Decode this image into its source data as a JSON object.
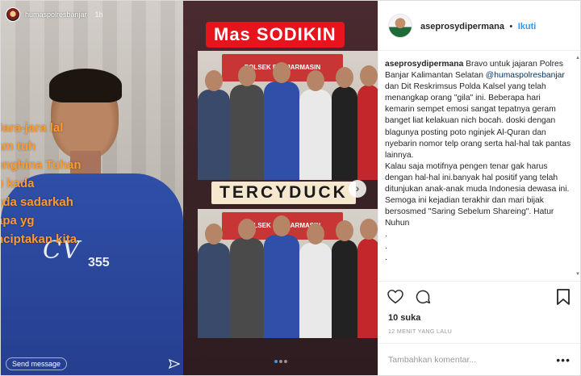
{
  "story": {
    "username": "humaspolresbanjar",
    "time": "1h",
    "lines": [
      "Jara-jara lal",
      "am tuh",
      "enghina Tuhan",
      "u kada",
      "ada sadarkah",
      "apa yg",
      "nciptakan kita"
    ],
    "send_message": "Send message",
    "shirt_text": "CV",
    "shirt_number": "355"
  },
  "right_media": {
    "name_badge": "Mas SODIKIN",
    "banner": "POLSEK BANJARMASIN",
    "overlay_text": "TERCYDUCK"
  },
  "post": {
    "username": "aseprosydipermana",
    "follow_label": "Ikuti",
    "caption_user": "aseprosydipermana",
    "caption_part1": " Bravo untuk jajaran Polres Banjar Kalimantan Selatan ",
    "caption_mention": "@humaspolresbanjar",
    "caption_part2": " dan Dit Reskrimsus Polda Kalsel yang telah menangkap orang \"gila\" ini. Beberapa hari kemarin sempet emosi sangat tepatnya geram banget liat kelakuan nich bocah. doski dengan blagunya posting poto nginjek Al-Quran dan nyebarin nomor telp orang serta hal-hal tak pantas lainnya.",
    "caption_part3": "Kalau saja motifnya pengen tenar gak harus dengan hal-hal ini.banyak hal positif yang telah ditunjukan anak-anak muda Indonesia dewasa ini. Semoga ini kejadian terakhir dan mari bijak bersosmed \"Saring Sebelum Shareing\". Hatur Nuhun",
    "dots": [
      ".",
      ".",
      "."
    ],
    "likes": "10 suka",
    "time_ago": "12 MENIT YANG LALU",
    "comment_placeholder": "Tambahkan komentar...",
    "more": "•••"
  },
  "colors": {
    "link": "#3897f0",
    "badge_red": "#e8141c",
    "story_text": "#ff9a2e"
  },
  "icons": [
    "heart-icon",
    "comment-icon",
    "bookmark-icon",
    "share-icon",
    "chevron-right-icon"
  ]
}
